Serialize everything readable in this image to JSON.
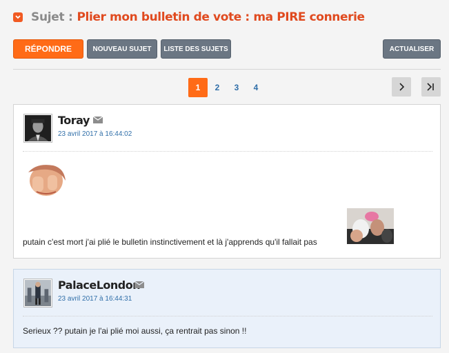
{
  "topic": {
    "prefix": "Sujet :",
    "title": "Plier mon bulletin de vote : ma PIRE connerie"
  },
  "toolbar": {
    "reply_label": "RÉPONDRE",
    "new_topic_label": "NOUVEAU SUJET",
    "topic_list_label": "LISTE DES SUJETS",
    "refresh_label": "ACTUALISER"
  },
  "pagination": {
    "pages": [
      "1",
      "2",
      "3",
      "4"
    ],
    "current": "1"
  },
  "posts": [
    {
      "author": "Toray",
      "date": "23 avril 2017 à 16:44:02",
      "message": "putain c'est mort j'ai plié le bulletin instinctivement et là j'apprends qu'il fallait pas"
    },
    {
      "author": "PalaceLondon",
      "date": "23 avril 2017 à 16:44:31",
      "message": "Serieux ?? putain je l'ai plié moi aussi, ça rentrait pas sinon !!"
    }
  ],
  "colors": {
    "accent": "#ff6b17",
    "title": "#e04a1f",
    "link": "#2f6ea8",
    "button_grey": "#6b7683"
  },
  "icons": {
    "toggle": "chevron-down-icon",
    "mail": "envelope-icon",
    "next": "chevron-right-icon",
    "last": "last-page-icon"
  }
}
